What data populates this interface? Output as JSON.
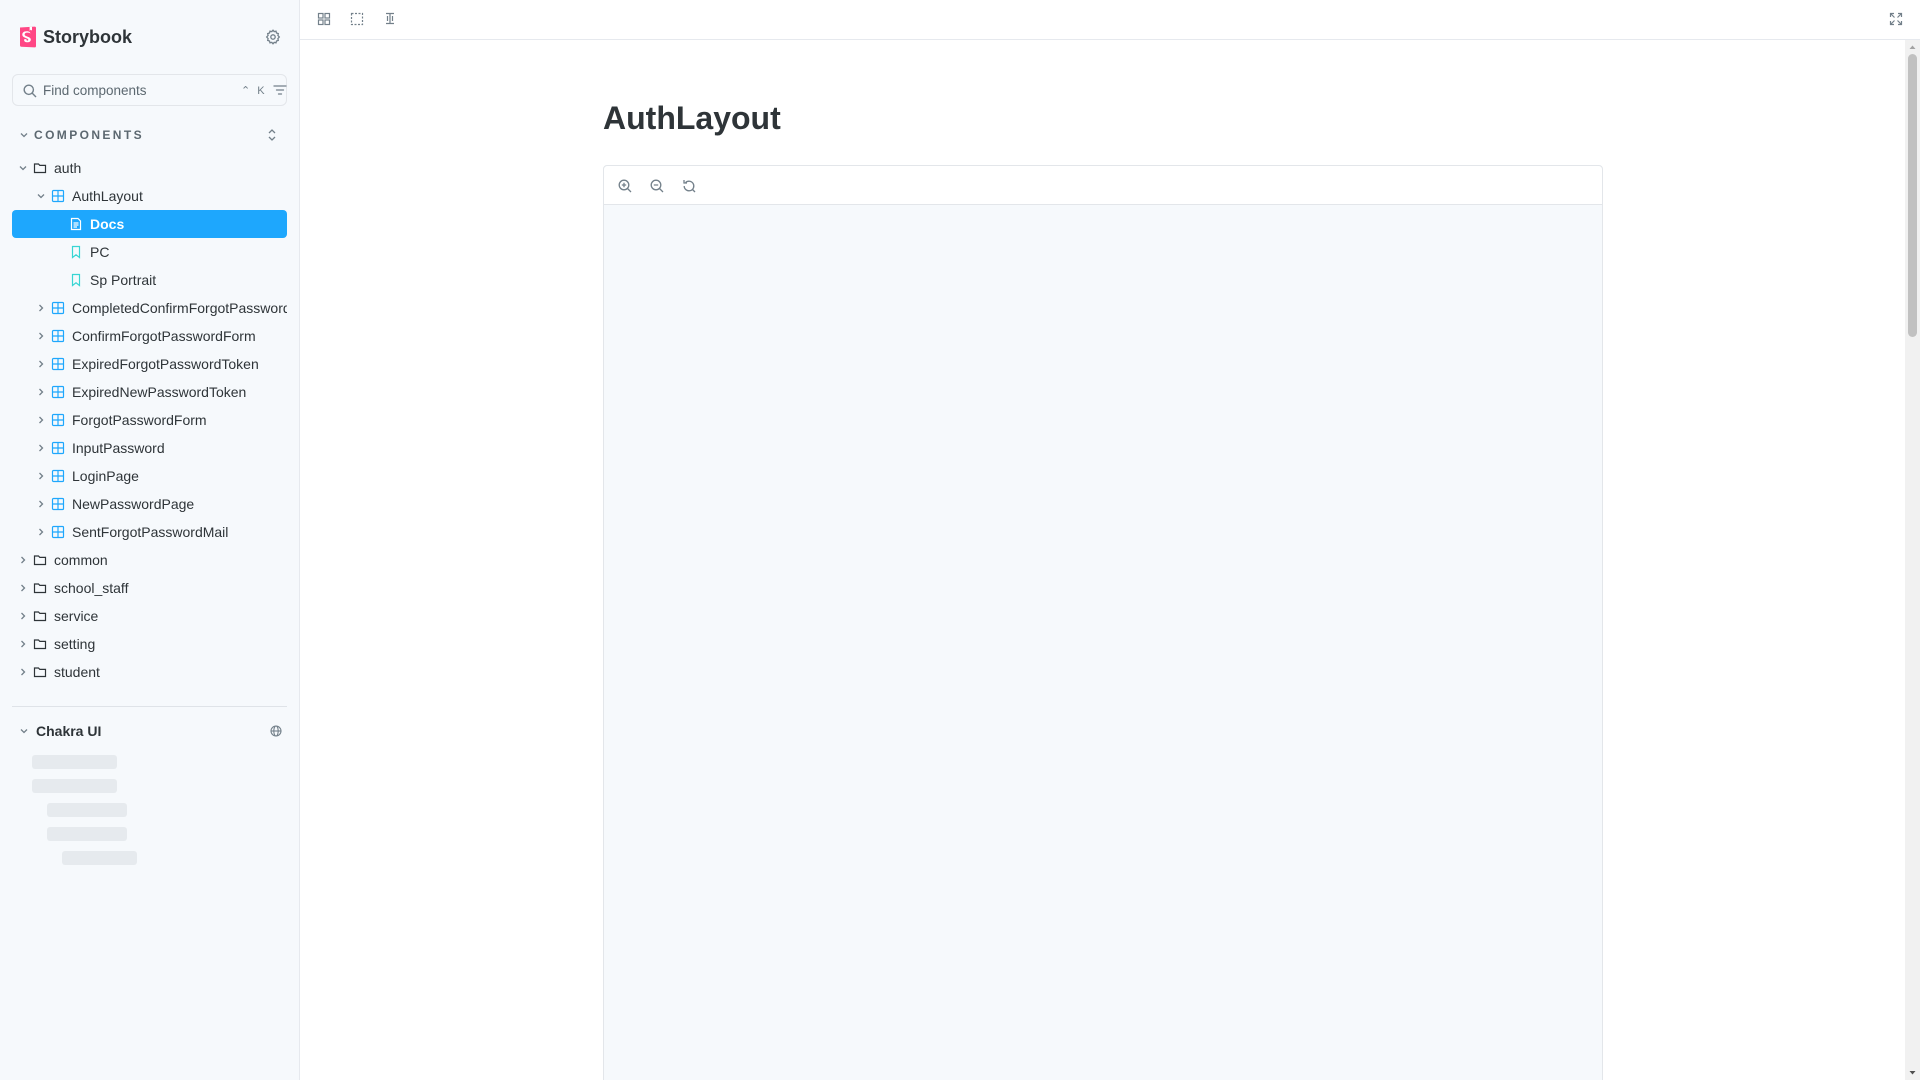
{
  "app": {
    "name": "Storybook"
  },
  "colors": {
    "accent": "#1ea7fd",
    "brand": "#ff4785",
    "component_icon": "#1ea7fd",
    "story_icon": "#37d5d3",
    "folder_icon": "#2e3438"
  },
  "search": {
    "placeholder": "Find components",
    "shortcut": "⌃ K"
  },
  "sidebar": {
    "section_label": "COMPONENTS",
    "tree": [
      {
        "label": "auth",
        "type": "folder",
        "expanded": true
      },
      {
        "label": "AuthLayout",
        "type": "component",
        "expanded": true
      },
      {
        "label": "Docs",
        "type": "docs",
        "selected": true
      },
      {
        "label": "PC",
        "type": "story"
      },
      {
        "label": "Sp Portrait",
        "type": "story"
      },
      {
        "label": "CompletedConfirmForgotPassword",
        "type": "component"
      },
      {
        "label": "ConfirmForgotPasswordForm",
        "type": "component"
      },
      {
        "label": "ExpiredForgotPasswordToken",
        "type": "component"
      },
      {
        "label": "ExpiredNewPasswordToken",
        "type": "component"
      },
      {
        "label": "ForgotPasswordForm",
        "type": "component"
      },
      {
        "label": "InputPassword",
        "type": "component"
      },
      {
        "label": "LoginPage",
        "type": "component"
      },
      {
        "label": "NewPasswordPage",
        "type": "component"
      },
      {
        "label": "SentForgotPasswordMail",
        "type": "component"
      },
      {
        "label": "common",
        "type": "folder"
      },
      {
        "label": "school_staff",
        "type": "folder"
      },
      {
        "label": "service",
        "type": "folder"
      },
      {
        "label": "setting",
        "type": "folder"
      },
      {
        "label": "student",
        "type": "folder"
      }
    ],
    "ref_label": "Chakra UI"
  },
  "toolbar": {
    "icons": [
      "grid-icon",
      "outline-icon",
      "measure-icon",
      "fullscreen-icon"
    ]
  },
  "docs": {
    "title": "AuthLayout"
  }
}
